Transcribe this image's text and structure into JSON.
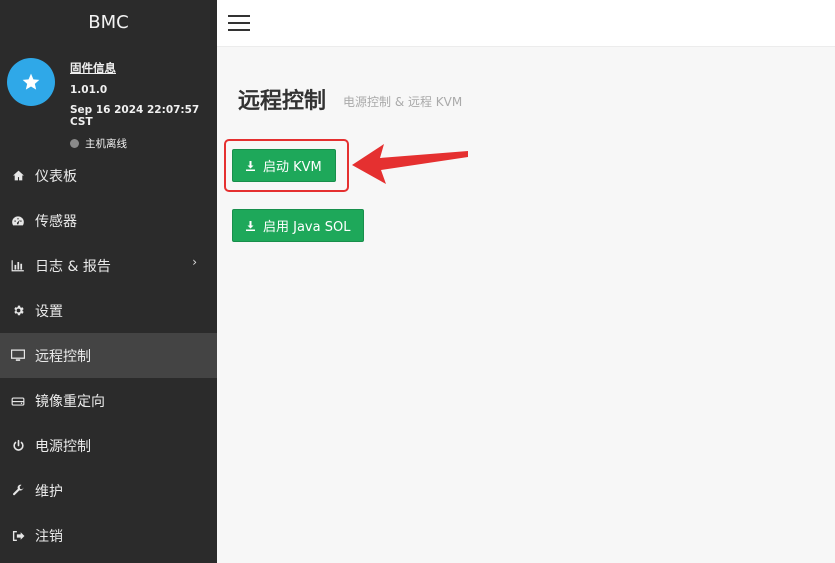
{
  "sidebar": {
    "brand": "BMC",
    "profile": {
      "firmware_label": "固件信息",
      "version": "1.01.0",
      "date": "Sep 16 2024 22:07:57 CST",
      "status": "主机离线"
    },
    "items": [
      {
        "label": "仪表板",
        "icon": "home-icon"
      },
      {
        "label": "传感器",
        "icon": "dashboard-gauge-icon"
      },
      {
        "label": "日志 & 报告",
        "icon": "bar-chart-icon"
      },
      {
        "label": "设置",
        "icon": "gear-icon"
      },
      {
        "label": "远程控制",
        "icon": "monitor-icon"
      },
      {
        "label": "镜像重定向",
        "icon": "drive-icon"
      },
      {
        "label": "电源控制",
        "icon": "power-icon"
      },
      {
        "label": "维护",
        "icon": "wrench-icon"
      },
      {
        "label": "注销",
        "icon": "logout-icon"
      }
    ]
  },
  "main": {
    "title": "远程控制",
    "subtitle": "电源控制 & 远程 KVM",
    "buttons": {
      "kvm": "启动 KVM",
      "sol": "启用 Java SOL"
    }
  },
  "colors": {
    "sidebar_bg": "#2b2b2b",
    "active_item": "#444444",
    "accent_green": "#1ea85a",
    "avatar_blue": "#2fa8e8",
    "highlight_red": "#e53030"
  }
}
